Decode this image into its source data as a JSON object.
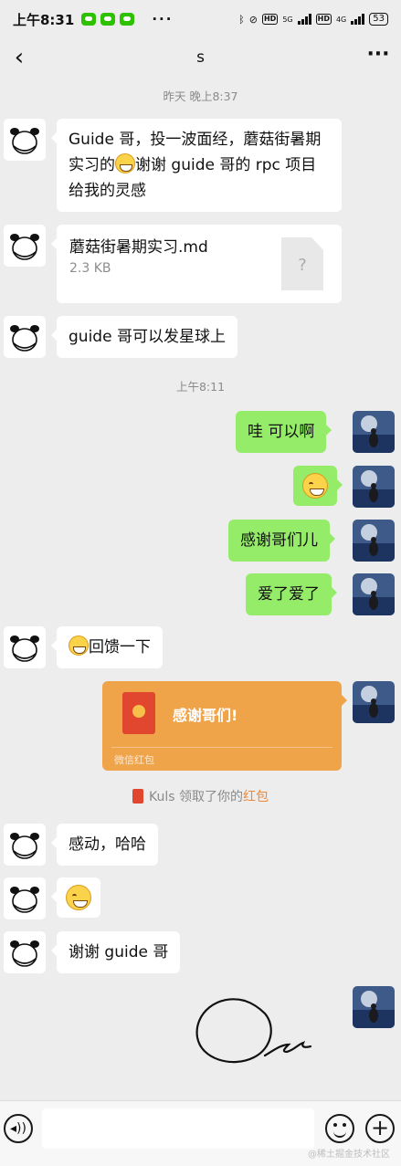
{
  "status_bar": {
    "time": "上午8:31",
    "overflow_dots": "···",
    "network_5g": "5G",
    "network_4g": "4G",
    "hd_label": "HD",
    "battery": "53"
  },
  "header": {
    "back_icon": "chevron-left-icon",
    "title": "s",
    "more_icon": "more-dots-icon",
    "more_label": "···"
  },
  "timestamps": [
    "昨天 晚上8:37",
    "上午8:11"
  ],
  "messages": [
    {
      "from": "other",
      "type": "text",
      "text_before_emoji": "Guide 哥，投一波面经，蘑菇街暑期实习的",
      "emoji": "grin-emoji",
      "text_after_emoji": "谢谢 guide 哥的 rpc 项目给我的灵感"
    },
    {
      "from": "other",
      "type": "file",
      "file_name": "蘑菇街暑期实习.md",
      "file_size": "2.3 KB",
      "file_icon_glyph": "?"
    },
    {
      "from": "other",
      "type": "text",
      "text": "guide 哥可以发星球上"
    },
    {
      "from": "self",
      "type": "text",
      "text": "哇  可以啊"
    },
    {
      "from": "self",
      "type": "emoji",
      "emoji": "grin-emoji"
    },
    {
      "from": "self",
      "type": "text",
      "text": "感谢哥们儿"
    },
    {
      "from": "self",
      "type": "text",
      "text": "爱了爱了"
    },
    {
      "from": "other",
      "type": "text",
      "emoji": "grin-emoji",
      "text": "回馈一下"
    },
    {
      "from": "self",
      "type": "red_packet",
      "title": "感谢哥们!",
      "label": "微信红包"
    },
    {
      "from": "other",
      "type": "text",
      "text": "感动，哈哈"
    },
    {
      "from": "other",
      "type": "emoji",
      "emoji": "smirk-emoji"
    },
    {
      "from": "other",
      "type": "text",
      "text": "谢谢 guide 哥"
    },
    {
      "from": "self",
      "type": "sticker",
      "sticker": "hand-drawn-doodle"
    }
  ],
  "system_message": {
    "before": "Kuls 领取了你的",
    "link": "红包"
  },
  "input_bar": {
    "voice_icon": "voice-icon",
    "voice_glyph": "◂))",
    "emoji_icon": "emoji-icon",
    "plus_icon": "plus-icon",
    "plus_glyph": "+",
    "input_value": ""
  },
  "watermark": "@稀土掘金技术社区",
  "colors": {
    "background": "#ededed",
    "outgoing_bubble": "#95ec69",
    "incoming_bubble": "#ffffff",
    "red_packet": "#f0a44a",
    "wechat_green": "#2dc100",
    "link_orange": "#e9893d"
  }
}
